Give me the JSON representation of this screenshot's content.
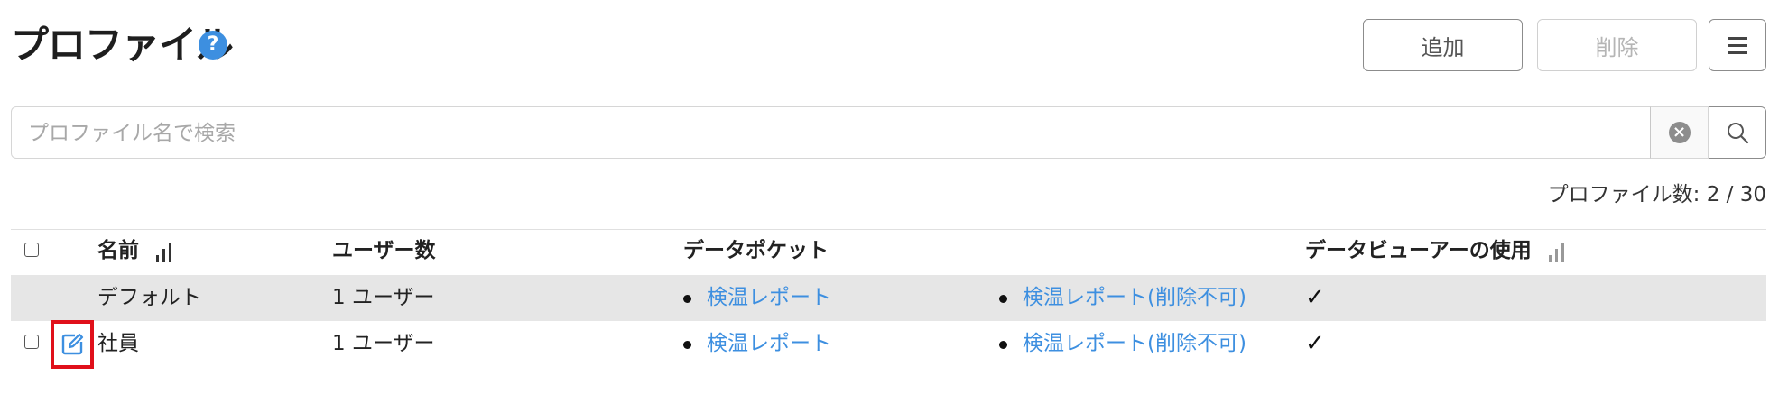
{
  "header": {
    "title": "プロファイル",
    "help_icon": "question-circle-icon",
    "add_label": "追加",
    "delete_label": "削除",
    "menu_icon": "hamburger-menu-icon"
  },
  "search": {
    "placeholder": "プロファイル名で検索",
    "value": "",
    "clear_icon": "clear-circle-icon",
    "search_icon": "magnifier-icon"
  },
  "profile_count": "プロファイル数: 2 / 30",
  "table": {
    "columns": {
      "name": "名前",
      "users": "ユーザー数",
      "pockets": "データポケット",
      "viewer": "データビューアーの使用"
    },
    "rows": [
      {
        "name": "デフォルト",
        "users": "1 ユーザー",
        "pockets": [
          "検温レポート",
          "検温レポート(削除不可)"
        ],
        "viewer": true,
        "selectable": false
      },
      {
        "name": "社員",
        "users": "1 ユーザー",
        "pockets": [
          "検温レポート",
          "検温レポート(削除不可)"
        ],
        "viewer": true,
        "selectable": true
      }
    ]
  },
  "colors": {
    "accent": "#3d8fe0",
    "highlight": "#e0101a",
    "row_shade": "#e6e6e6"
  }
}
